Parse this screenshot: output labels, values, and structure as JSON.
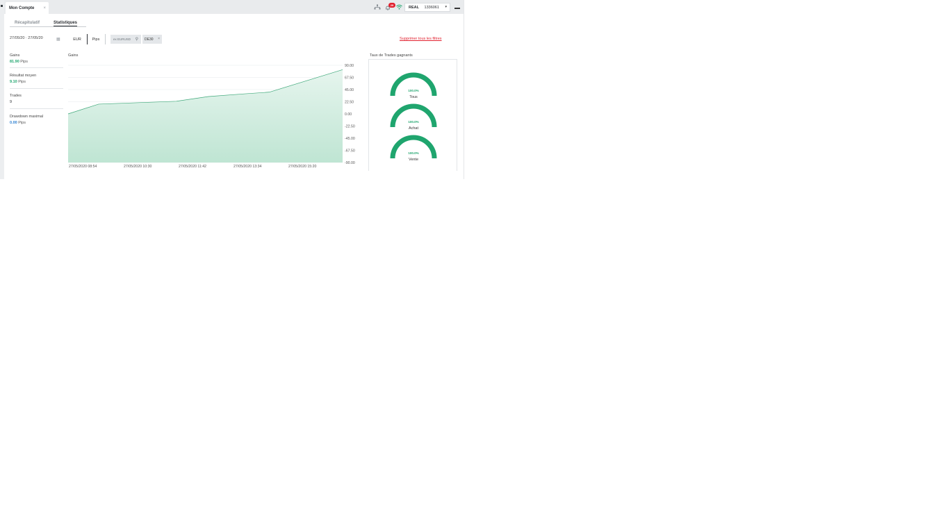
{
  "window": {
    "tab_title": "Mon Compte",
    "tab_close": "×"
  },
  "topbar": {
    "icons": [
      "network-icon",
      "bell-icon",
      "wifi-icon"
    ],
    "notification_count": "29",
    "account_type": "REAL",
    "account_number": "1336061",
    "caret": "▾"
  },
  "subtabs": [
    {
      "label": "Récapitulatif",
      "active": false
    },
    {
      "label": "Statistiques",
      "active": true
    }
  ],
  "filters": {
    "date_range": "27/05/20 · 27/05/20",
    "unit_options": [
      "EUR",
      "Pips"
    ],
    "selected_unit": "Pips",
    "search_placeholder": "ex EURUSD",
    "instrument_chip": "DE30",
    "chip_close": "×",
    "delete_filters": "Supprimer tous les filtres"
  },
  "stats": [
    {
      "label": "Gains",
      "value": "81.90",
      "unit": "Pips",
      "color": "#1fa56e"
    },
    {
      "label": "Résultat moyen",
      "value": "9.10",
      "unit": "Pips",
      "color": "#1fa56e"
    },
    {
      "label": "Trades",
      "value": "9",
      "unit": "",
      "color": "#2c2f33"
    },
    {
      "label": "Drawdown maximal",
      "value": "0.00",
      "unit": "Pips",
      "color": "#2c7fd1"
    }
  ],
  "gains_section_title": "Gains",
  "winrate_section_title": "Taux de Trades gagnants",
  "gauges": [
    {
      "name": "Tous",
      "value": "100.0%",
      "fraction": 1.0
    },
    {
      "name": "Achat",
      "value": "100.0%",
      "fraction": 1.0
    },
    {
      "name": "Vente",
      "value": "100.0%",
      "fraction": 1.0
    }
  ],
  "colors": {
    "accent_green": "#1fa56e",
    "area_fill": "#d4eee3",
    "alert_red": "#e2202e"
  },
  "chart_data": {
    "type": "area",
    "title": "Gains",
    "x_tick_labels": [
      "27/05/2020 08:54",
      "27/05/2020 10:30",
      "27/05/2020 11:42",
      "27/05/2020 13:34",
      "27/05/2020 15:20"
    ],
    "y_tick_labels": [
      "90.00",
      "67.50",
      "45.00",
      "22.50",
      "0.00",
      "-22.50",
      "-45.00",
      "-67.50",
      "-90.00"
    ],
    "ylim": [
      -90,
      90
    ],
    "xlim": [
      0,
      9
    ],
    "y_axis_position": "right",
    "grid": true,
    "x": [
      0,
      1,
      3.55,
      4.6,
      5.8,
      6.6,
      9.0
    ],
    "y": [
      0.0,
      18.1,
      23.4,
      32.1,
      37.2,
      40.3,
      81.9
    ]
  }
}
